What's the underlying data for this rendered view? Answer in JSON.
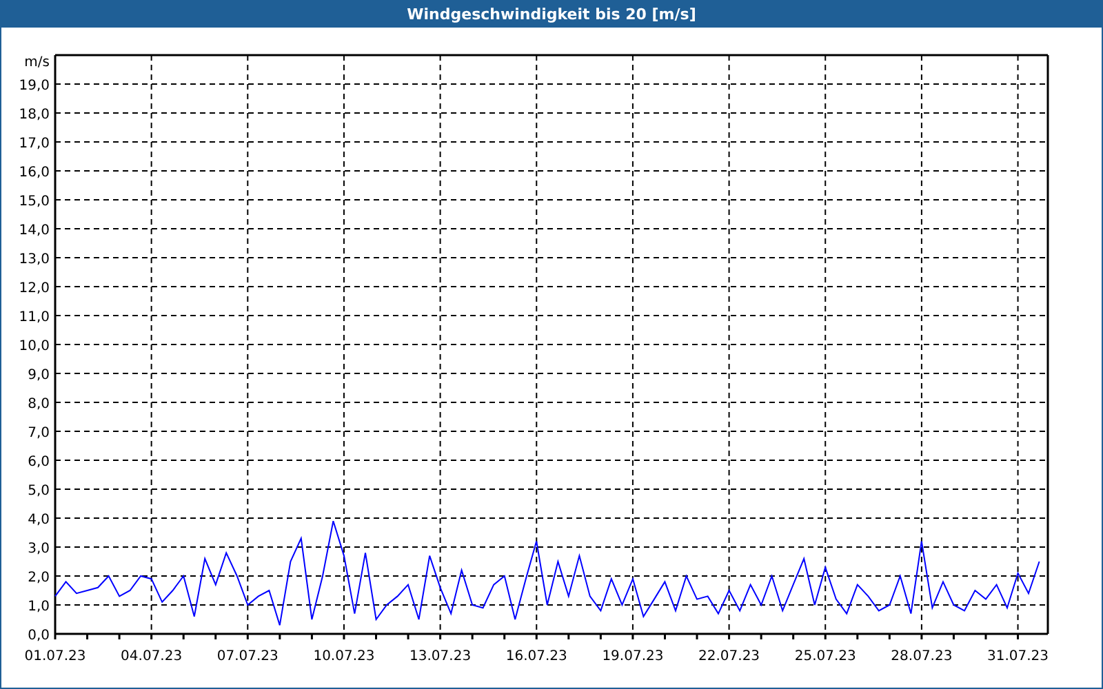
{
  "chart_data": {
    "type": "line",
    "title": "Windgeschwindigkeit bis 20 [m/s]",
    "ylabel": "m/s",
    "grid": true,
    "ylim": [
      0,
      20
    ],
    "categories": [
      "01.07.23",
      null,
      null,
      null,
      null,
      null,
      null,
      null,
      null,
      "04.07.23",
      null,
      null,
      null,
      null,
      null,
      null,
      null,
      null,
      "07.07.23",
      null,
      null,
      null,
      null,
      null,
      null,
      null,
      null,
      "10.07.23",
      null,
      null,
      null,
      null,
      null,
      null,
      null,
      null,
      "13.07.23",
      null,
      null,
      null,
      null,
      null,
      null,
      null,
      null,
      "16.07.23",
      null,
      null,
      null,
      null,
      null,
      null,
      null,
      null,
      "19.07.23",
      null,
      null,
      null,
      null,
      null,
      null,
      null,
      null,
      "22.07.23",
      null,
      null,
      null,
      null,
      null,
      null,
      null,
      null,
      "25.07.23",
      null,
      null,
      null,
      null,
      null,
      null,
      null,
      null,
      "28.07.23",
      null,
      null,
      null,
      null,
      null,
      null,
      null,
      null,
      "31.07.23",
      null,
      null
    ],
    "yticks": [
      {
        "value": 0,
        "label": "0,0"
      },
      {
        "value": 1,
        "label": "1,0"
      },
      {
        "value": 2,
        "label": "2,0"
      },
      {
        "value": 3,
        "label": "3,0"
      },
      {
        "value": 4,
        "label": "4,0"
      },
      {
        "value": 5,
        "label": "5,0"
      },
      {
        "value": 6,
        "label": "6,0"
      },
      {
        "value": 7,
        "label": "7,0"
      },
      {
        "value": 8,
        "label": "8,0"
      },
      {
        "value": 9,
        "label": "9,0"
      },
      {
        "value": 10,
        "label": "10,0"
      },
      {
        "value": 11,
        "label": "11,0"
      },
      {
        "value": 12,
        "label": "12,0"
      },
      {
        "value": 13,
        "label": "13,0"
      },
      {
        "value": 14,
        "label": "14,0"
      },
      {
        "value": 15,
        "label": "15,0"
      },
      {
        "value": 16,
        "label": "16,0"
      },
      {
        "value": 17,
        "label": "17,0"
      },
      {
        "value": 18,
        "label": "18,0"
      },
      {
        "value": 19,
        "label": "19,0"
      }
    ],
    "series": [
      {
        "color": "#0000ff",
        "values": [
          1.3,
          1.8,
          1.4,
          1.5,
          1.6,
          2.0,
          1.3,
          1.5,
          2.0,
          1.9,
          1.1,
          1.5,
          2.0,
          0.6,
          2.6,
          1.7,
          2.8,
          2.0,
          1.0,
          1.3,
          1.5,
          0.3,
          2.5,
          3.3,
          0.5,
          2.0,
          3.9,
          2.7,
          0.7,
          2.8,
          0.5,
          1.0,
          1.3,
          1.7,
          0.5,
          2.7,
          1.6,
          0.7,
          2.2,
          1.0,
          0.9,
          1.7,
          2.0,
          0.5,
          1.9,
          3.2,
          1.0,
          2.5,
          1.3,
          2.7,
          1.3,
          0.8,
          1.9,
          1.0,
          1.9,
          0.6,
          1.2,
          1.8,
          0.8,
          2.0,
          1.2,
          1.3,
          0.7,
          1.5,
          0.8,
          1.7,
          1.0,
          2.0,
          0.8,
          1.7,
          2.6,
          1.0,
          2.3,
          1.2,
          0.7,
          1.7,
          1.3,
          0.8,
          1.0,
          2.0,
          0.7,
          3.2,
          0.9,
          1.8,
          1.0,
          0.8,
          1.5,
          1.2,
          1.7,
          0.9,
          2.1,
          1.4,
          2.5
        ]
      }
    ]
  }
}
